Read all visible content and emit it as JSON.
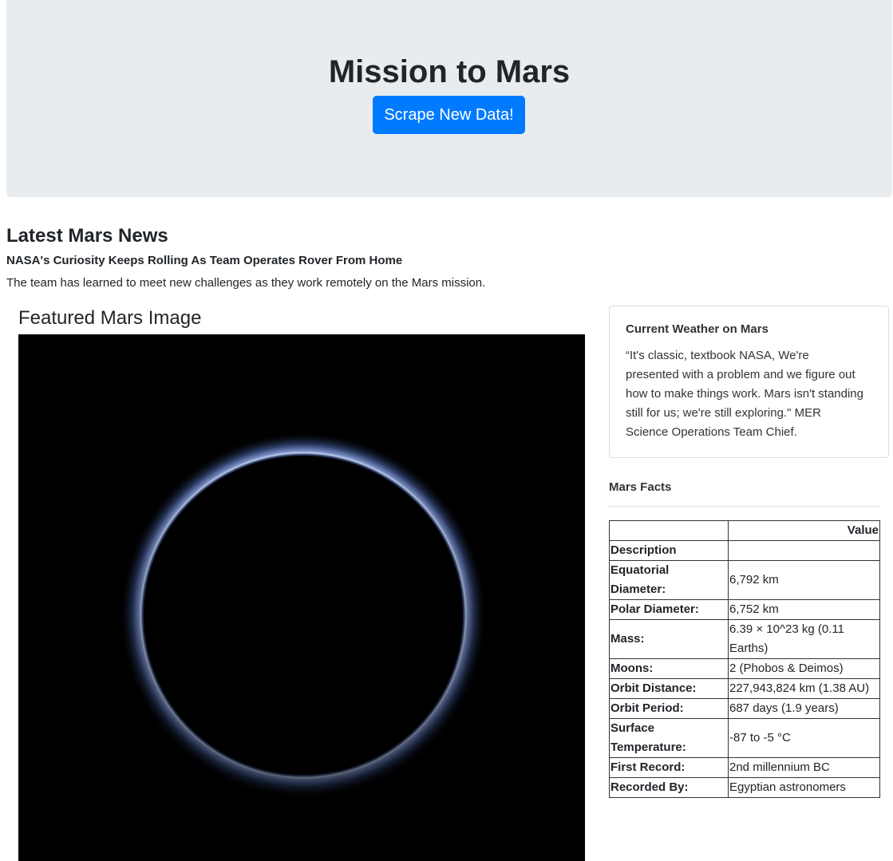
{
  "header": {
    "title": "Mission to Mars",
    "scrape_button": "Scrape New Data!"
  },
  "news": {
    "heading": "Latest Mars News",
    "title": "NASA's Curiosity Keeps Rolling As Team Operates Rover From Home",
    "paragraph": "The team has learned to meet new challenges as they work remotely on the Mars mission."
  },
  "featured": {
    "heading": "Featured Mars Image"
  },
  "weather": {
    "title": "Current Weather on Mars",
    "text": "“It's classic, textbook NASA, We're presented with a problem and we figure out how to make things work. Mars isn't standing still for us; we're still exploring.\" MER Science Operations Team Chief."
  },
  "facts": {
    "title": "Mars Facts",
    "header_value": "Value",
    "header_description": "Description",
    "rows": [
      {
        "label": "Equatorial Diameter:",
        "value": "6,792 km"
      },
      {
        "label": "Polar Diameter:",
        "value": "6,752 km"
      },
      {
        "label": "Mass:",
        "value": "6.39 × 10^23 kg (0.11 Earths)"
      },
      {
        "label": "Moons:",
        "value": "2 (Phobos & Deimos)"
      },
      {
        "label": "Orbit Distance:",
        "value": "227,943,824 km (1.38 AU)"
      },
      {
        "label": "Orbit Period:",
        "value": "687 days (1.9 years)"
      },
      {
        "label": "Surface Temperature:",
        "value": "-87 to -5 °C"
      },
      {
        "label": "First Record:",
        "value": "2nd millennium BC"
      },
      {
        "label": "Recorded By:",
        "value": "Egyptian astronomers"
      }
    ]
  }
}
